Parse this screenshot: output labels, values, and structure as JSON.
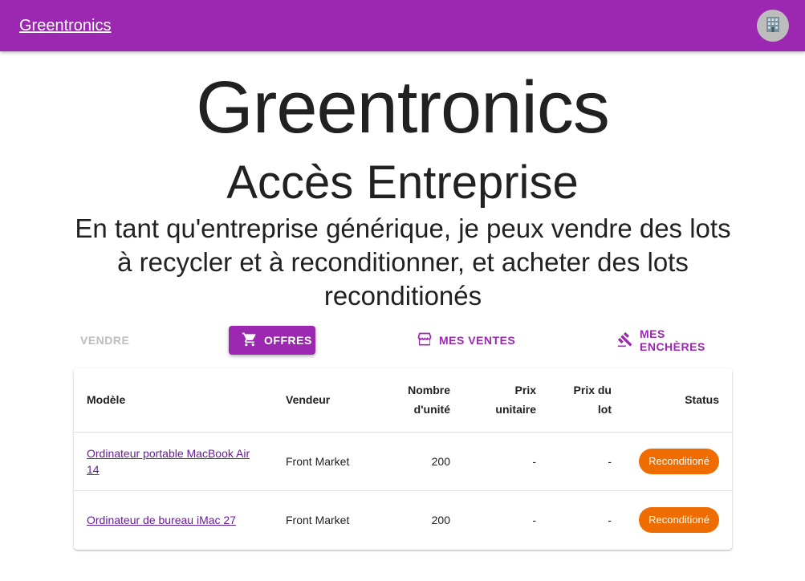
{
  "appbar": {
    "brand": "Greentronics",
    "avatar_icon": "building-icon"
  },
  "hero": {
    "title": "Greentronics",
    "subtitle": "Accès Entreprise",
    "description": "En tant qu'entreprise générique, je peux vendre des lots à recycler et à reconditionner, et acheter des lots reconditionés"
  },
  "tabs": [
    {
      "label": "Vendre",
      "state": "disabled"
    },
    {
      "label": "Offres",
      "state": "active",
      "icon": "cart-icon"
    },
    {
      "label": "Mes ventes",
      "state": "normal",
      "icon": "store-icon"
    },
    {
      "label": "Mes enchères",
      "state": "normal",
      "icon": "gavel-icon"
    }
  ],
  "table": {
    "headers": {
      "model": "Modèle",
      "vendor": "Vendeur",
      "qty_line1": "Nombre",
      "qty_line2": "d'unité",
      "unit_line1": "Prix",
      "unit_line2": "unitaire",
      "lot_line1": "Prix du",
      "lot_line2": "lot",
      "status": "Status"
    },
    "rows": [
      {
        "model": "Ordinateur portable MacBook Air 14",
        "vendor": "Front Market",
        "qty": "200",
        "unit_price": "-",
        "lot_price": "-",
        "status": "Reconditioné"
      },
      {
        "model": "Ordinateur de bureau iMac 27",
        "vendor": "Front Market",
        "qty": "200",
        "unit_price": "-",
        "lot_price": "-",
        "status": "Reconditioné"
      }
    ]
  },
  "colors": {
    "primary": "#9c27b0",
    "status_chip": "#ef6c00",
    "link": "#6a1b9a"
  }
}
